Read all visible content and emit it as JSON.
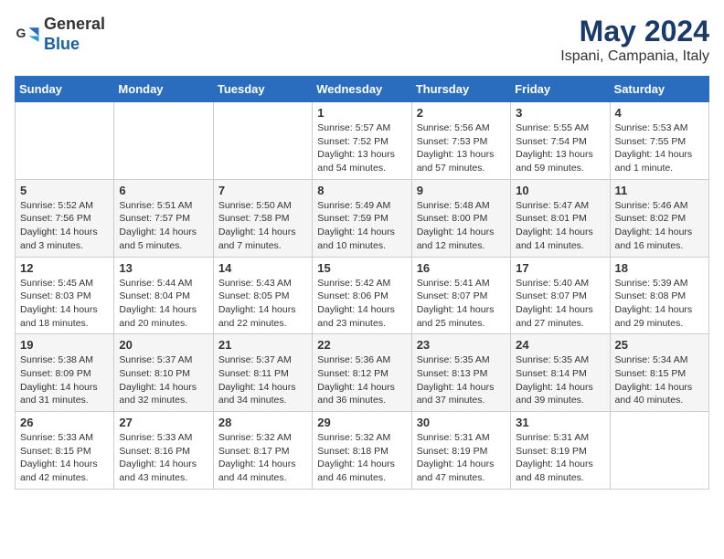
{
  "header": {
    "logo_general": "General",
    "logo_blue": "Blue",
    "month": "May 2024",
    "location": "Ispani, Campania, Italy"
  },
  "days_of_week": [
    "Sunday",
    "Monday",
    "Tuesday",
    "Wednesday",
    "Thursday",
    "Friday",
    "Saturday"
  ],
  "weeks": [
    [
      {
        "day": "",
        "info": ""
      },
      {
        "day": "",
        "info": ""
      },
      {
        "day": "",
        "info": ""
      },
      {
        "day": "1",
        "info": "Sunrise: 5:57 AM\nSunset: 7:52 PM\nDaylight: 13 hours\nand 54 minutes."
      },
      {
        "day": "2",
        "info": "Sunrise: 5:56 AM\nSunset: 7:53 PM\nDaylight: 13 hours\nand 57 minutes."
      },
      {
        "day": "3",
        "info": "Sunrise: 5:55 AM\nSunset: 7:54 PM\nDaylight: 13 hours\nand 59 minutes."
      },
      {
        "day": "4",
        "info": "Sunrise: 5:53 AM\nSunset: 7:55 PM\nDaylight: 14 hours\nand 1 minute."
      }
    ],
    [
      {
        "day": "5",
        "info": "Sunrise: 5:52 AM\nSunset: 7:56 PM\nDaylight: 14 hours\nand 3 minutes."
      },
      {
        "day": "6",
        "info": "Sunrise: 5:51 AM\nSunset: 7:57 PM\nDaylight: 14 hours\nand 5 minutes."
      },
      {
        "day": "7",
        "info": "Sunrise: 5:50 AM\nSunset: 7:58 PM\nDaylight: 14 hours\nand 7 minutes."
      },
      {
        "day": "8",
        "info": "Sunrise: 5:49 AM\nSunset: 7:59 PM\nDaylight: 14 hours\nand 10 minutes."
      },
      {
        "day": "9",
        "info": "Sunrise: 5:48 AM\nSunset: 8:00 PM\nDaylight: 14 hours\nand 12 minutes."
      },
      {
        "day": "10",
        "info": "Sunrise: 5:47 AM\nSunset: 8:01 PM\nDaylight: 14 hours\nand 14 minutes."
      },
      {
        "day": "11",
        "info": "Sunrise: 5:46 AM\nSunset: 8:02 PM\nDaylight: 14 hours\nand 16 minutes."
      }
    ],
    [
      {
        "day": "12",
        "info": "Sunrise: 5:45 AM\nSunset: 8:03 PM\nDaylight: 14 hours\nand 18 minutes."
      },
      {
        "day": "13",
        "info": "Sunrise: 5:44 AM\nSunset: 8:04 PM\nDaylight: 14 hours\nand 20 minutes."
      },
      {
        "day": "14",
        "info": "Sunrise: 5:43 AM\nSunset: 8:05 PM\nDaylight: 14 hours\nand 22 minutes."
      },
      {
        "day": "15",
        "info": "Sunrise: 5:42 AM\nSunset: 8:06 PM\nDaylight: 14 hours\nand 23 minutes."
      },
      {
        "day": "16",
        "info": "Sunrise: 5:41 AM\nSunset: 8:07 PM\nDaylight: 14 hours\nand 25 minutes."
      },
      {
        "day": "17",
        "info": "Sunrise: 5:40 AM\nSunset: 8:07 PM\nDaylight: 14 hours\nand 27 minutes."
      },
      {
        "day": "18",
        "info": "Sunrise: 5:39 AM\nSunset: 8:08 PM\nDaylight: 14 hours\nand 29 minutes."
      }
    ],
    [
      {
        "day": "19",
        "info": "Sunrise: 5:38 AM\nSunset: 8:09 PM\nDaylight: 14 hours\nand 31 minutes."
      },
      {
        "day": "20",
        "info": "Sunrise: 5:37 AM\nSunset: 8:10 PM\nDaylight: 14 hours\nand 32 minutes."
      },
      {
        "day": "21",
        "info": "Sunrise: 5:37 AM\nSunset: 8:11 PM\nDaylight: 14 hours\nand 34 minutes."
      },
      {
        "day": "22",
        "info": "Sunrise: 5:36 AM\nSunset: 8:12 PM\nDaylight: 14 hours\nand 36 minutes."
      },
      {
        "day": "23",
        "info": "Sunrise: 5:35 AM\nSunset: 8:13 PM\nDaylight: 14 hours\nand 37 minutes."
      },
      {
        "day": "24",
        "info": "Sunrise: 5:35 AM\nSunset: 8:14 PM\nDaylight: 14 hours\nand 39 minutes."
      },
      {
        "day": "25",
        "info": "Sunrise: 5:34 AM\nSunset: 8:15 PM\nDaylight: 14 hours\nand 40 minutes."
      }
    ],
    [
      {
        "day": "26",
        "info": "Sunrise: 5:33 AM\nSunset: 8:15 PM\nDaylight: 14 hours\nand 42 minutes."
      },
      {
        "day": "27",
        "info": "Sunrise: 5:33 AM\nSunset: 8:16 PM\nDaylight: 14 hours\nand 43 minutes."
      },
      {
        "day": "28",
        "info": "Sunrise: 5:32 AM\nSunset: 8:17 PM\nDaylight: 14 hours\nand 44 minutes."
      },
      {
        "day": "29",
        "info": "Sunrise: 5:32 AM\nSunset: 8:18 PM\nDaylight: 14 hours\nand 46 minutes."
      },
      {
        "day": "30",
        "info": "Sunrise: 5:31 AM\nSunset: 8:19 PM\nDaylight: 14 hours\nand 47 minutes."
      },
      {
        "day": "31",
        "info": "Sunrise: 5:31 AM\nSunset: 8:19 PM\nDaylight: 14 hours\nand 48 minutes."
      },
      {
        "day": "",
        "info": ""
      }
    ]
  ]
}
